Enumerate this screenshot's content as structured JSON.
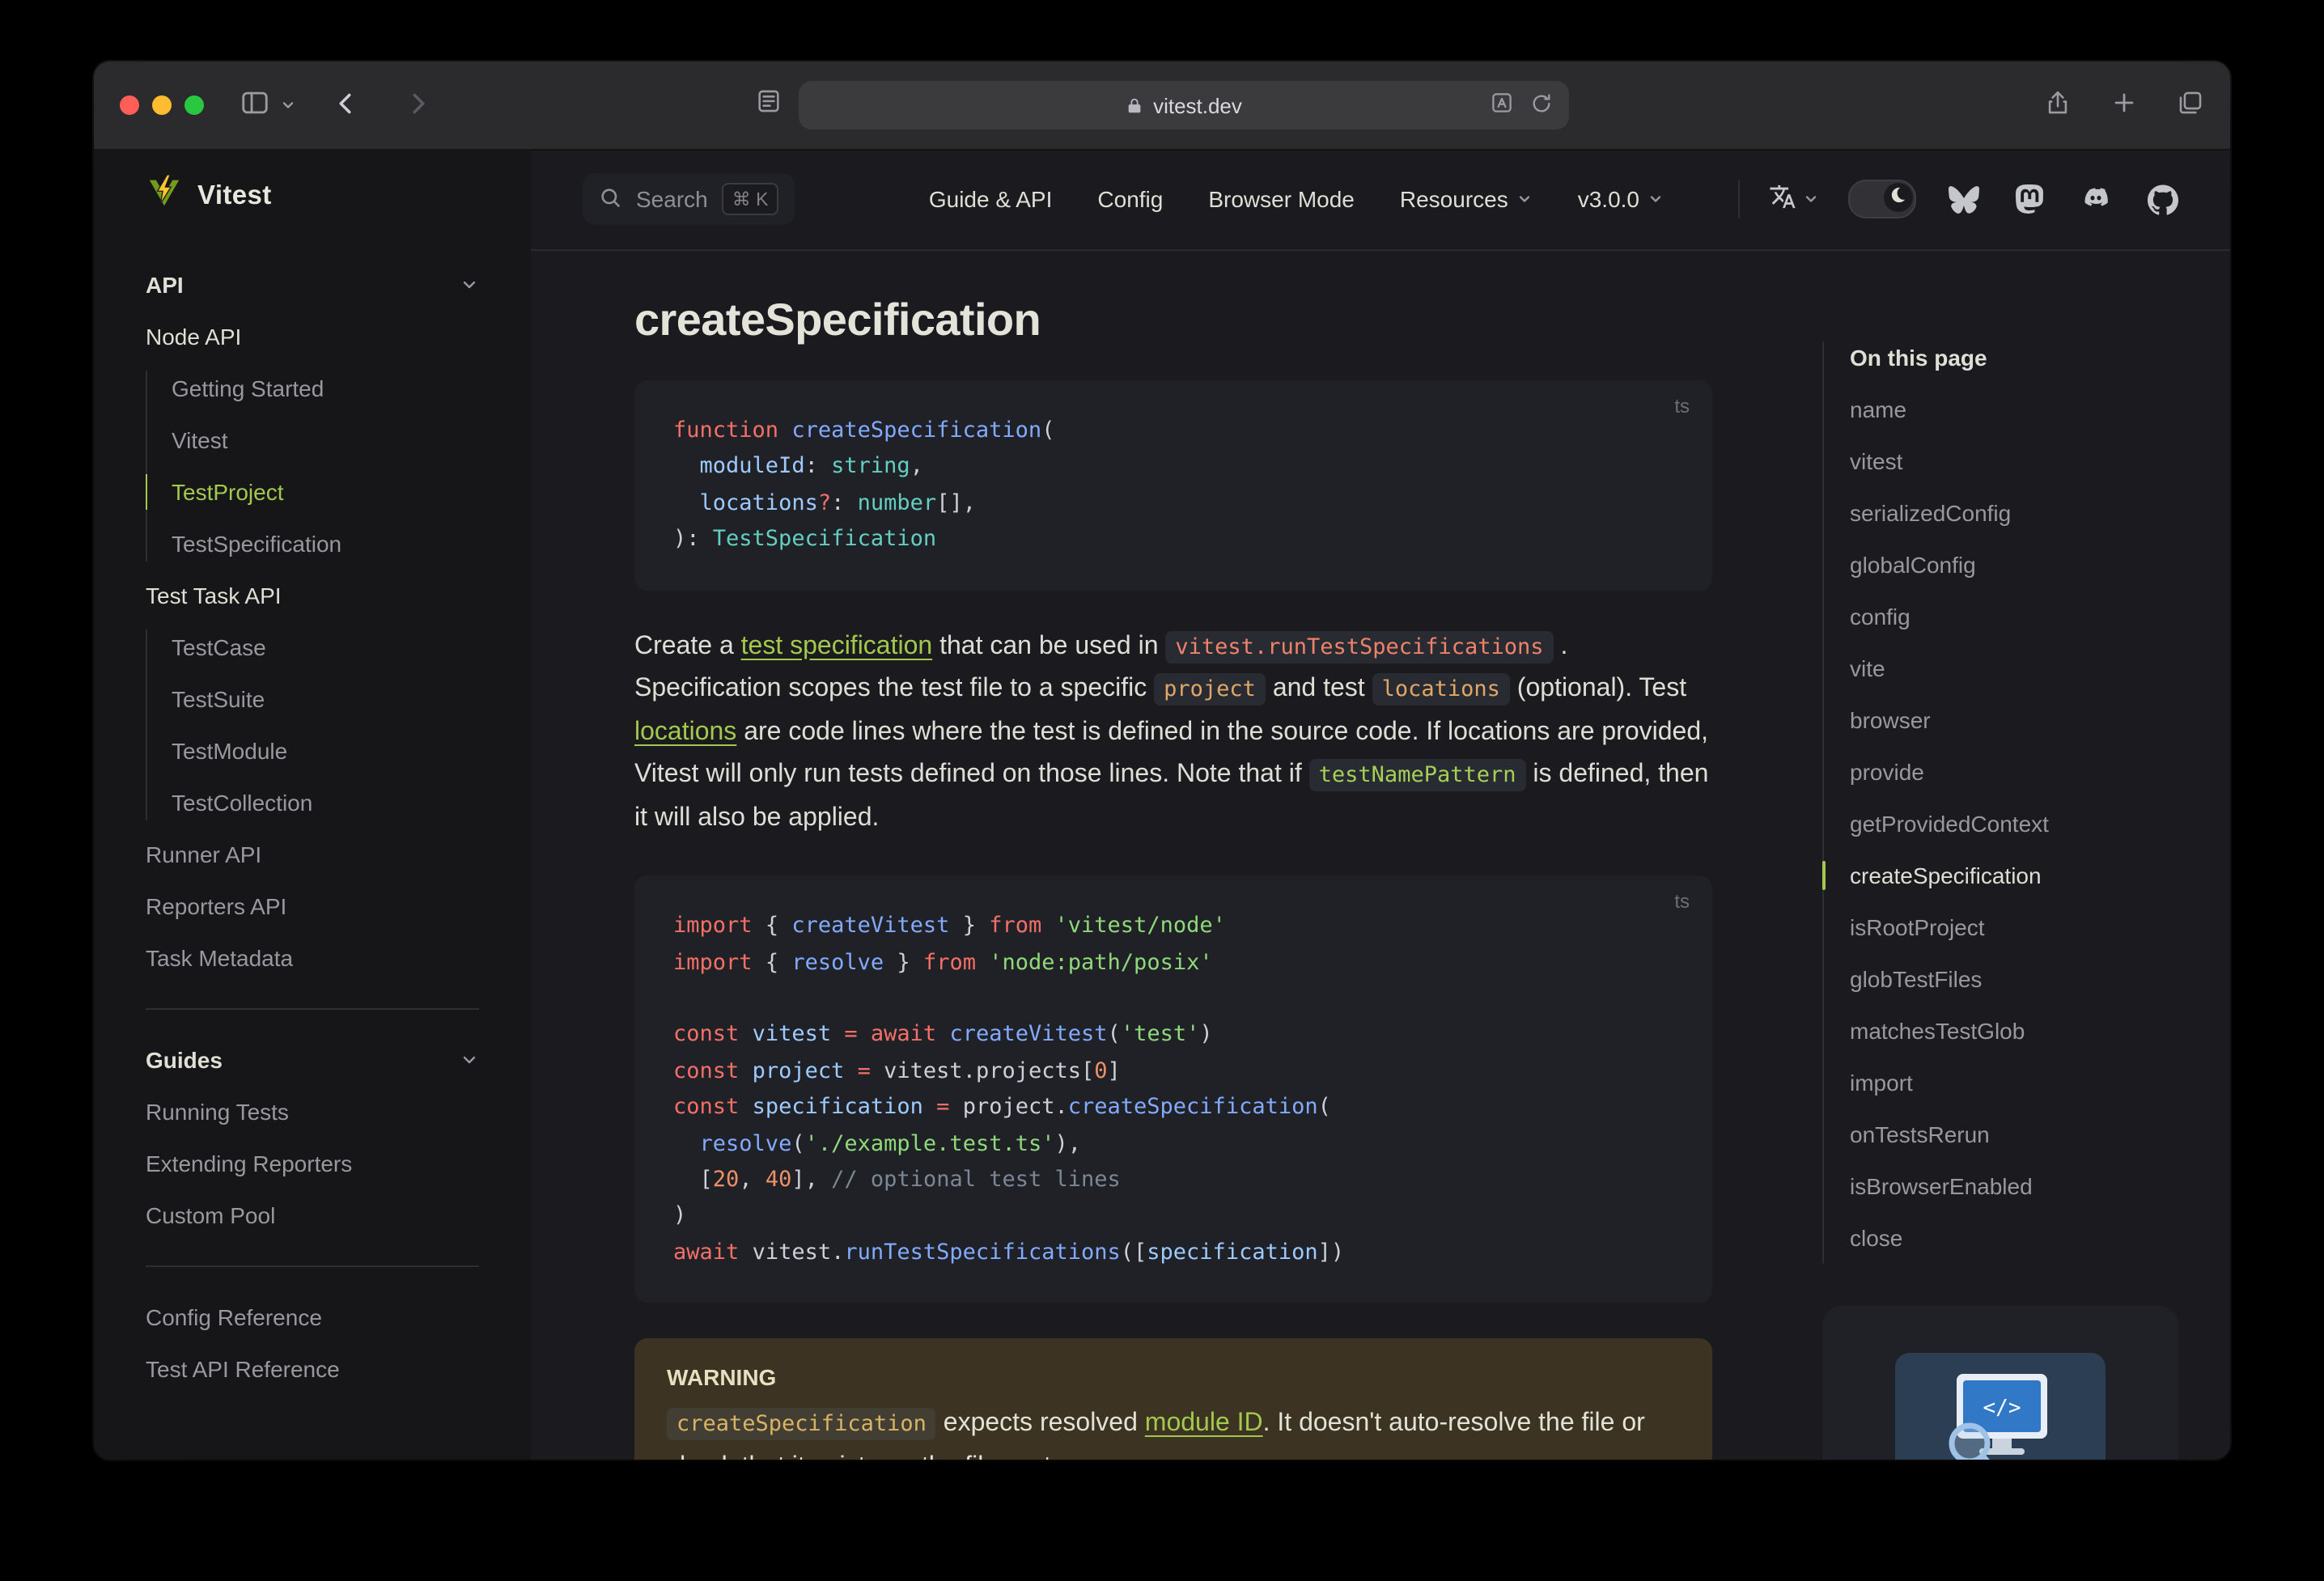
{
  "colors": {
    "brand": "#a2c84d",
    "page_bg": "#1b1b1f",
    "sidebar_bg": "#161618",
    "code_bg": "#202127",
    "warning_bg": "#3c3322",
    "traffic": [
      "#ff5f57",
      "#febc2e",
      "#28c840"
    ]
  },
  "browser": {
    "url": "vitest.dev"
  },
  "icons": {
    "logo": "vitest-lightning-bolt",
    "search": "magnifier",
    "command_kbd": "⌘ K",
    "translate": "文A",
    "theme_toggle": "moon",
    "socials": [
      "bluesky",
      "mastodon",
      "discord",
      "github"
    ],
    "toolbar": [
      "sidebar-panel",
      "chevron-down",
      "back",
      "forward",
      "page",
      "lock",
      "translate",
      "reload",
      "share",
      "plus",
      "tab-overview"
    ]
  },
  "sidebar": {
    "brand": "Vitest",
    "sections": [
      {
        "type": "header",
        "label": "API",
        "chevron": true
      },
      {
        "type": "group",
        "label": "Node API",
        "items": [
          {
            "label": "Getting Started"
          },
          {
            "label": "Vitest"
          },
          {
            "label": "TestProject",
            "active": true
          },
          {
            "label": "TestSpecification"
          }
        ]
      },
      {
        "type": "group",
        "label": "Test Task API",
        "items": [
          {
            "label": "TestCase"
          },
          {
            "label": "TestSuite"
          },
          {
            "label": "TestModule"
          },
          {
            "label": "TestCollection"
          }
        ]
      },
      {
        "type": "link",
        "label": "Runner API"
      },
      {
        "type": "link",
        "label": "Reporters API"
      },
      {
        "type": "link",
        "label": "Task Metadata"
      },
      {
        "type": "divider"
      },
      {
        "type": "header",
        "label": "Guides",
        "chevron": true
      },
      {
        "type": "link",
        "label": "Running Tests"
      },
      {
        "type": "link",
        "label": "Extending Reporters"
      },
      {
        "type": "link",
        "label": "Custom Pool"
      },
      {
        "type": "divider"
      },
      {
        "type": "link",
        "label": "Config Reference"
      },
      {
        "type": "link",
        "label": "Test API Reference"
      }
    ]
  },
  "nav": {
    "search": {
      "label": "Search",
      "kbd": "⌘ K"
    },
    "links": [
      {
        "label": "Guide & API"
      },
      {
        "label": "Config"
      },
      {
        "label": "Browser Mode"
      },
      {
        "label": "Resources",
        "chevron": true
      },
      {
        "label": "v3.0.0",
        "chevron": true
      }
    ],
    "socials": [
      "bluesky",
      "mastodon",
      "discord",
      "github"
    ]
  },
  "content": {
    "title": "createSpecification",
    "code_blocks": [
      {
        "lang": "ts",
        "lines": [
          [
            {
              "c": "kw",
              "t": "function "
            },
            {
              "c": "fn",
              "t": "createSpecification"
            },
            {
              "c": "pun",
              "t": "("
            }
          ],
          [
            {
              "c": "pun",
              "t": "  "
            },
            {
              "c": "var",
              "t": "moduleId"
            },
            {
              "c": "pun",
              "t": ": "
            },
            {
              "c": "type",
              "t": "string"
            },
            {
              "c": "pun",
              "t": ","
            }
          ],
          [
            {
              "c": "pun",
              "t": "  "
            },
            {
              "c": "var",
              "t": "locations"
            },
            {
              "c": "kw",
              "t": "?"
            },
            {
              "c": "pun",
              "t": ": "
            },
            {
              "c": "type",
              "t": "number"
            },
            {
              "c": "pun",
              "t": "[],"
            }
          ],
          [
            {
              "c": "pun",
              "t": "): "
            },
            {
              "c": "type",
              "t": "TestSpecification"
            }
          ]
        ]
      },
      {
        "lang": "ts",
        "lines": [
          [
            {
              "c": "kw",
              "t": "import"
            },
            {
              "c": "pun",
              "t": " { "
            },
            {
              "c": "fn",
              "t": "createVitest"
            },
            {
              "c": "pun",
              "t": " } "
            },
            {
              "c": "kw",
              "t": "from"
            },
            {
              "c": "pun",
              "t": " "
            },
            {
              "c": "str",
              "t": "'vitest/node'"
            }
          ],
          [
            {
              "c": "kw",
              "t": "import"
            },
            {
              "c": "pun",
              "t": " { "
            },
            {
              "c": "fn",
              "t": "resolve"
            },
            {
              "c": "pun",
              "t": " } "
            },
            {
              "c": "kw",
              "t": "from"
            },
            {
              "c": "pun",
              "t": " "
            },
            {
              "c": "str",
              "t": "'node:path/posix'"
            }
          ],
          [],
          [
            {
              "c": "kw",
              "t": "const "
            },
            {
              "c": "var",
              "t": "vitest"
            },
            {
              "c": "kw",
              "t": " = await "
            },
            {
              "c": "fn",
              "t": "createVitest"
            },
            {
              "c": "pun",
              "t": "("
            },
            {
              "c": "str",
              "t": "'test'"
            },
            {
              "c": "pun",
              "t": ")"
            }
          ],
          [
            {
              "c": "kw",
              "t": "const "
            },
            {
              "c": "var",
              "t": "project"
            },
            {
              "c": "kw",
              "t": " = "
            },
            {
              "c": "pun",
              "t": "vitest.projects["
            },
            {
              "c": "num",
              "t": "0"
            },
            {
              "c": "pun",
              "t": "]"
            }
          ],
          [
            {
              "c": "kw",
              "t": "const "
            },
            {
              "c": "var",
              "t": "specification"
            },
            {
              "c": "kw",
              "t": " = "
            },
            {
              "c": "pun",
              "t": "project."
            },
            {
              "c": "fn",
              "t": "createSpecification"
            },
            {
              "c": "pun",
              "t": "("
            }
          ],
          [
            {
              "c": "pun",
              "t": "  "
            },
            {
              "c": "fn",
              "t": "resolve"
            },
            {
              "c": "pun",
              "t": "("
            },
            {
              "c": "str",
              "t": "'./example.test.ts'"
            },
            {
              "c": "pun",
              "t": "),"
            }
          ],
          [
            {
              "c": "pun",
              "t": "  ["
            },
            {
              "c": "num",
              "t": "20"
            },
            {
              "c": "pun",
              "t": ", "
            },
            {
              "c": "num",
              "t": "40"
            },
            {
              "c": "pun",
              "t": "], "
            },
            {
              "c": "cmt",
              "t": "// optional test lines"
            }
          ],
          [
            {
              "c": "pun",
              "t": ")"
            }
          ],
          [
            {
              "c": "kw",
              "t": "await "
            },
            {
              "c": "pun",
              "t": "vitest."
            },
            {
              "c": "fn",
              "t": "runTestSpecifications"
            },
            {
              "c": "pun",
              "t": "(["
            },
            {
              "c": "var",
              "t": "specification"
            },
            {
              "c": "pun",
              "t": "])"
            }
          ]
        ]
      }
    ],
    "paragraph": [
      {
        "k": "text",
        "t": "Create a "
      },
      {
        "k": "link",
        "t": "test specification"
      },
      {
        "k": "text",
        "t": " that can be used in "
      },
      {
        "k": "code",
        "t": "vitest.runTestSpecifications",
        "color": "red"
      },
      {
        "k": "text",
        "t": " . Specification scopes the test file to a specific "
      },
      {
        "k": "code",
        "t": "project",
        "color": "amber"
      },
      {
        "k": "text",
        "t": " and test "
      },
      {
        "k": "code",
        "t": "locations",
        "color": "amber"
      },
      {
        "k": "text",
        "t": " (optional). Test "
      },
      {
        "k": "link",
        "t": "locations"
      },
      {
        "k": "text",
        "t": " are code lines where the test is defined in the source code. If locations are provided, Vitest will only run tests defined on those lines. Note that if "
      },
      {
        "k": "code",
        "t": "testNamePattern",
        "color": "green"
      },
      {
        "k": "text",
        "t": " is defined, then it will also be applied."
      }
    ],
    "warning": {
      "title": "WARNING",
      "body": [
        {
          "k": "code",
          "t": "createSpecification",
          "color": "yellow"
        },
        {
          "k": "text",
          "t": " expects resolved "
        },
        {
          "k": "link",
          "t": "module ID"
        },
        {
          "k": "text",
          "t": ". It doesn't auto-resolve the file or check that it exists on the file system."
        }
      ]
    }
  },
  "outline": {
    "title": "On this page",
    "items": [
      {
        "label": "name"
      },
      {
        "label": "vitest"
      },
      {
        "label": "serializedConfig"
      },
      {
        "label": "globalConfig"
      },
      {
        "label": "config"
      },
      {
        "label": "vite"
      },
      {
        "label": "browser"
      },
      {
        "label": "provide"
      },
      {
        "label": "getProvidedContext"
      },
      {
        "label": "createSpecification",
        "active": true
      },
      {
        "label": "isRootProject"
      },
      {
        "label": "globTestFiles"
      },
      {
        "label": "matchesTestGlob"
      },
      {
        "label": "import"
      },
      {
        "label": "onTestsRerun"
      },
      {
        "label": "isBrowserEnabled"
      },
      {
        "label": "close"
      }
    ]
  }
}
